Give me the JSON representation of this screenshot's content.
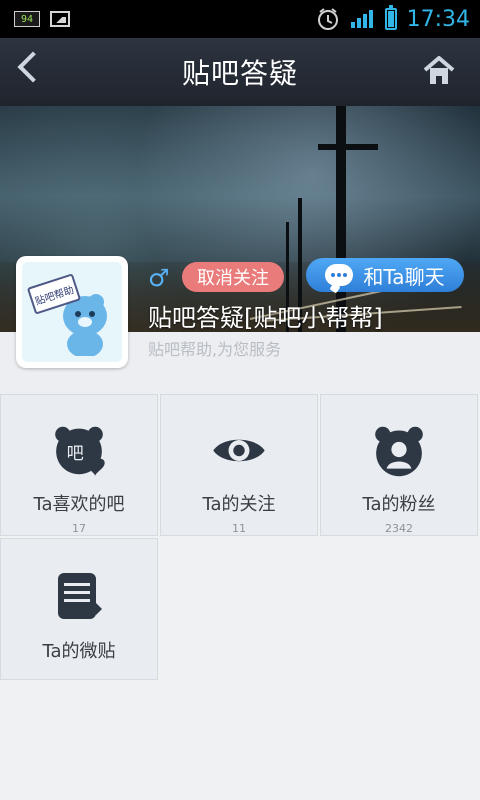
{
  "status_bar": {
    "badge": "94",
    "time": "17:34"
  },
  "header": {
    "title": "贴吧答疑"
  },
  "profile": {
    "gender_symbol": "♂",
    "unfollow_label": "取消关注",
    "chat_label": "和Ta聊天",
    "name": "贴吧答疑[贴吧小帮帮]",
    "description": "贴吧帮助,为您服务",
    "avatar_sign": "贴吧帮助"
  },
  "grid": {
    "items": [
      {
        "label": "Ta喜欢的吧",
        "count": "17",
        "icon": "bar-heart-icon"
      },
      {
        "label": "Ta的关注",
        "count": "11",
        "icon": "eye-icon"
      },
      {
        "label": "Ta的粉丝",
        "count": "2342",
        "icon": "fans-icon"
      },
      {
        "label": "Ta的微贴",
        "count": "",
        "icon": "micro-post-icon"
      }
    ]
  },
  "colors": {
    "status_accent": "#31b6e7",
    "unfollow": "#e97b7b",
    "chat": "#2f7fd8"
  }
}
